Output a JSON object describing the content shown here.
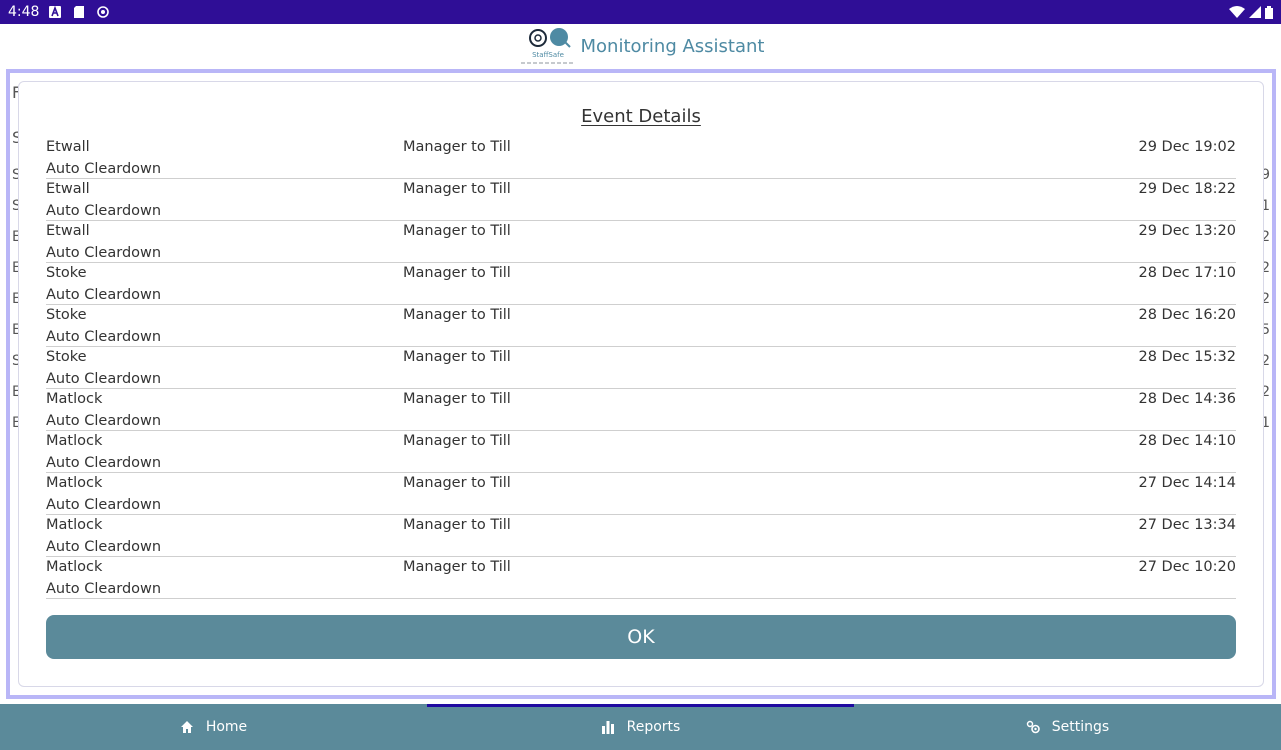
{
  "status_bar": {
    "time": "4:48"
  },
  "header": {
    "title": "Monitoring Assistant",
    "logo_text": "StaffSafe"
  },
  "background_fragments": {
    "left": [
      "F",
      "S",
      "S",
      "S",
      "E",
      "E",
      "E",
      "E",
      "S",
      "E",
      "E"
    ],
    "right": [
      "9",
      "1",
      "2",
      "2",
      "2",
      "5",
      "2",
      "2",
      "1"
    ]
  },
  "dialog": {
    "title": "Event Details",
    "events": [
      {
        "site": "Etwall",
        "type": "Manager to Till",
        "time": "29 Dec 19:02",
        "action": "Auto Cleardown"
      },
      {
        "site": "Etwall",
        "type": "Manager to Till",
        "time": "29 Dec 18:22",
        "action": "Auto Cleardown"
      },
      {
        "site": "Etwall",
        "type": "Manager to Till",
        "time": "29 Dec 13:20",
        "action": "Auto Cleardown"
      },
      {
        "site": "Stoke",
        "type": "Manager to Till",
        "time": "28 Dec 17:10",
        "action": "Auto Cleardown"
      },
      {
        "site": "Stoke",
        "type": "Manager to Till",
        "time": "28 Dec 16:20",
        "action": "Auto Cleardown"
      },
      {
        "site": "Stoke",
        "type": "Manager to Till",
        "time": "28 Dec 15:32",
        "action": "Auto Cleardown"
      },
      {
        "site": "Matlock",
        "type": "Manager to Till",
        "time": "28 Dec 14:36",
        "action": "Auto Cleardown"
      },
      {
        "site": "Matlock",
        "type": "Manager to Till",
        "time": "28 Dec 14:10",
        "action": "Auto Cleardown"
      },
      {
        "site": "Matlock",
        "type": "Manager to Till",
        "time": "27 Dec 14:14",
        "action": "Auto Cleardown"
      },
      {
        "site": "Matlock",
        "type": "Manager to Till",
        "time": "27 Dec 13:34",
        "action": "Auto Cleardown"
      },
      {
        "site": "Matlock",
        "type": "Manager to Till",
        "time": "27 Dec 10:20",
        "action": "Auto Cleardown"
      }
    ],
    "ok_label": "OK"
  },
  "bottom_nav": {
    "items": [
      {
        "label": "Home",
        "icon": "home-icon"
      },
      {
        "label": "Reports",
        "icon": "bar-chart-icon"
      },
      {
        "label": "Settings",
        "icon": "gear-icon"
      }
    ],
    "active_index": 1
  },
  "colors": {
    "status_bar": "#2f0e96",
    "header_title": "#4e8aa3",
    "accent": "#5b8a9a",
    "frame": "#b9b6f7",
    "nav_active": "#1f0aa0"
  }
}
